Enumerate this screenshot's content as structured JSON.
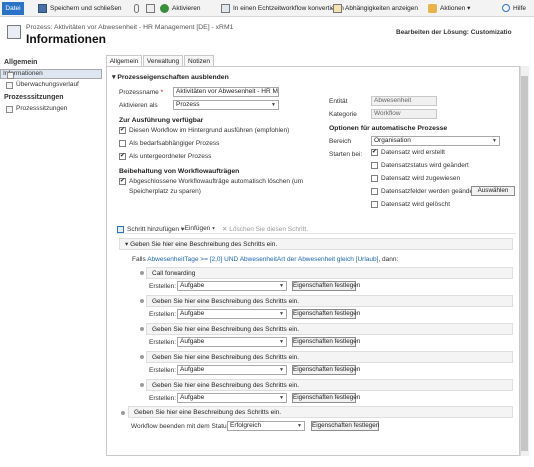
{
  "ribbon": {
    "file_tab": "Datei",
    "save_close": "Speichern und schließen",
    "activate": "Aktivieren",
    "convert": "In einen Echtzeitworkflow konvertieren",
    "dependencies": "Abhängigkeiten anzeigen",
    "actions": "Aktionen",
    "help": "Hilfe"
  },
  "header": {
    "process_line": "Prozess: Aktivitäten vor Abwesenheit - HR Management [DE] - xRM1",
    "title": "Informationen",
    "solution": "Bearbeiten der Lösung: Customizatio"
  },
  "nav": {
    "general_heading": "Allgemein",
    "general_items": [
      "Informationen",
      "Überwachungsverlauf"
    ],
    "sessions_heading": "Prozesssitzungen",
    "sessions_items": [
      "Prozesssitzungen"
    ]
  },
  "tabs": [
    "Allgemein",
    "Verwaltung",
    "Notizen"
  ],
  "section_title": "Prozesseigenschaften ausblenden",
  "form": {
    "process_name_label": "Prozessname",
    "required_marker": "*",
    "process_name_value": "Aktivitäten vor Abwesenheit - HR Mana",
    "activate_as_label": "Aktivieren als",
    "activate_as_value": "Prozess",
    "entity_label": "Entität",
    "entity_value": "Abwesenheit",
    "category_label": "Kategorie",
    "category_value": "Workflow"
  },
  "available": {
    "heading": "Zur Ausführung verfügbar",
    "options": [
      {
        "label": "Diesen Workflow im Hintergrund ausführen (empfohlen)",
        "checked": true
      },
      {
        "label": "Als bedarfsabhängiger Prozess",
        "checked": false
      },
      {
        "label": "Als untergeordneter Prozess",
        "checked": true
      }
    ]
  },
  "retention": {
    "heading": "Beibehaltung von Workflowaufträgen",
    "option_line1": "Abgeschlossene Workflowaufträge automatisch löschen (um",
    "option_line2": "Speicherplatz zu sparen)",
    "checked": true
  },
  "auto": {
    "heading": "Optionen für automatische Prozesse",
    "scope_label": "Bereich",
    "scope_value": "Organisation",
    "start_label": "Starten bei:",
    "options": [
      {
        "label": "Datensatz wird erstellt",
        "checked": true
      },
      {
        "label": "Datensatzstatus wird geändert",
        "checked": false
      },
      {
        "label": "Datensatz wird zugewiesen",
        "checked": false
      },
      {
        "label": "Datensatzfelder werden geändert",
        "checked": false
      },
      {
        "label": "Datensatz wird gelöscht",
        "checked": false
      }
    ],
    "select_button": "Auswählen"
  },
  "steps_toolbar": {
    "add_step": "Schritt hinzufügen",
    "insert": "Einfügen",
    "delete": "Löschen Sie diesen Schritt."
  },
  "steps": {
    "top_description": "Geben Sie hier eine Beschreibung des Schritts ein.",
    "condition_prefix": "Falls",
    "condition_link": "AbwesenheitTage >= [2,0] UND AbwesenheitArt der Abwesenheit gleich [Urlaub]",
    "condition_suffix": ", dann:",
    "create_label": "Erstellen:",
    "properties_button": "Eigenschaften festlegen",
    "sub_steps": [
      {
        "title": "Call forwarding",
        "type": "Aufgabe"
      },
      {
        "title": "Geben Sie hier eine Beschreibung des Schritts ein.",
        "type": "Aufgabe"
      },
      {
        "title": "Geben Sie hier eine Beschreibung des Schritts ein.",
        "type": "Aufgabe"
      },
      {
        "title": "Geben Sie hier eine Beschreibung des Schritts ein.",
        "type": "Aufgabe"
      },
      {
        "title": "Geben Sie hier eine Beschreibung des Schritts ein.",
        "type": "Aufgabe"
      }
    ],
    "bottom_description": "Geben Sie hier eine Beschreibung des Schritts ein.",
    "end_label": "Workflow beenden mit dem Status:",
    "end_value": "Erfolgreich"
  },
  "colors": {
    "file_tab": "#2b73c6",
    "link": "#1e64b4"
  }
}
